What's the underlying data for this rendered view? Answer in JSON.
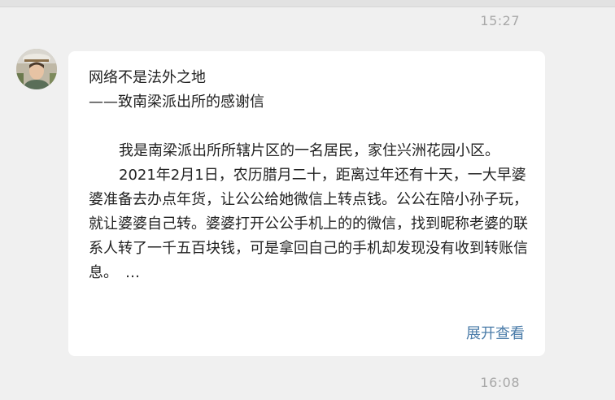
{
  "chat": {
    "timestamp_top": "15:27",
    "timestamp_bottom": "16:08"
  },
  "message": {
    "title": "网络不是法外之地",
    "subtitle": "——致南梁派出所的感谢信",
    "paragraphs": [
      "我是南梁派出所所辖片区的一名居民，家住兴洲花园小区。",
      "2021年2月1日，农历腊月二十，距离过年还有十天，一大早婆婆准备去办点年货，让公公给她微信上转点钱。公公在陪小孙子玩，就让婆婆自己转。婆婆打开公公手机上的的微信，找到昵称老婆的联系人转了一千五百块钱，可是拿回自己的手机却发现没有收到转账信息。　…"
    ],
    "expand_label": "展开查看"
  }
}
